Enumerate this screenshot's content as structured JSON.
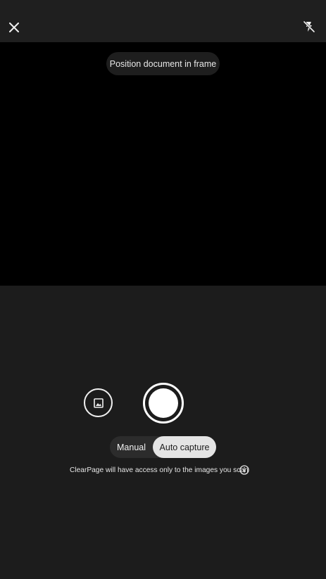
{
  "header": {
    "close_icon": "close-icon",
    "flash_icon": "flash-off-icon"
  },
  "viewfinder": {
    "hint": "Position document in frame"
  },
  "controls": {
    "gallery_icon": "image-icon",
    "shutter_label": "shutter",
    "modes": [
      {
        "label": "Manual",
        "selected": false
      },
      {
        "label": "Auto capture",
        "selected": true
      }
    ]
  },
  "footer": {
    "privacy_text": "ClearPage will have access only to the images you scan",
    "info_icon": "info-icon"
  },
  "colors": {
    "background": "#1c1c1c",
    "viewfinder": "#000000",
    "accent": "#ffffff",
    "selected_mode_bg": "#e4e4e4"
  }
}
